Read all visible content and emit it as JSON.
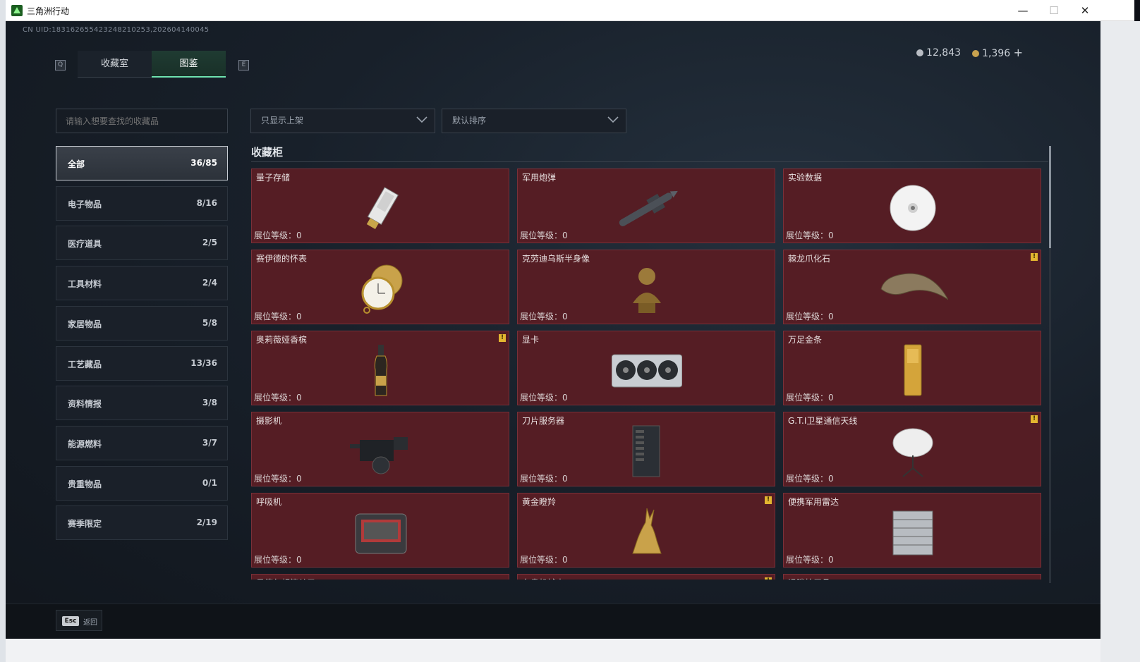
{
  "window": {
    "title": "三角洲行动",
    "controls": [
      "minimize",
      "maximize",
      "close"
    ]
  },
  "header": {
    "uid": "CN UID:1831626554232482102­53,202604140045",
    "silver": "12,843",
    "gold": "1,396",
    "gold_add": "+"
  },
  "tabs": {
    "prev_key": "Q",
    "next_key": "E",
    "items": [
      {
        "label": "收藏室"
      },
      {
        "label": "图鉴",
        "active": true
      }
    ]
  },
  "search": {
    "placeholder": "请输入想要查找的收藏品"
  },
  "filters": {
    "display": "只显示上架",
    "sort": "默认排序"
  },
  "categories": [
    {
      "label": "全部",
      "count": "36/85",
      "active": true
    },
    {
      "label": "电子物品",
      "count": "8/16"
    },
    {
      "label": "医疗道具",
      "count": "2/5"
    },
    {
      "label": "工具材料",
      "count": "2/4"
    },
    {
      "label": "家居物品",
      "count": "5/8"
    },
    {
      "label": "工艺藏品",
      "count": "13/36"
    },
    {
      "label": "资料情报",
      "count": "3/8"
    },
    {
      "label": "能源燃料",
      "count": "3/7"
    },
    {
      "label": "贵重物品",
      "count": "0/1"
    },
    {
      "label": "赛季限定",
      "count": "2/19"
    }
  ],
  "panel": {
    "title": "收藏柜",
    "level_label": "展位等级：0"
  },
  "items": [
    {
      "name": "量子存储",
      "icon": "usb-drive-icon",
      "alert": false
    },
    {
      "name": "军用炮弹",
      "icon": "missile-icon",
      "alert": false
    },
    {
      "name": "实验数据",
      "icon": "disc-icon",
      "alert": false
    },
    {
      "name": "赛伊德的怀表",
      "icon": "pocket-watch-icon",
      "alert": false
    },
    {
      "name": "克劳迪乌斯半身像",
      "icon": "bust-icon",
      "alert": false
    },
    {
      "name": "棘龙爪化石",
      "icon": "claw-fossil-icon",
      "alert": true
    },
    {
      "name": "奥莉薇娅香槟",
      "icon": "champagne-icon",
      "alert": true
    },
    {
      "name": "显卡",
      "icon": "graphics-card-icon",
      "alert": false
    },
    {
      "name": "万足金条",
      "icon": "gold-bar-icon",
      "alert": false
    },
    {
      "name": "摄影机",
      "icon": "camera-icon",
      "alert": false
    },
    {
      "name": "刀片服务器",
      "icon": "server-icon",
      "alert": false
    },
    {
      "name": "G.T.I卫星通信天线",
      "icon": "satellite-dish-icon",
      "alert": true
    },
    {
      "name": "呼吸机",
      "icon": "ventilator-icon",
      "alert": false
    },
    {
      "name": "黄金瞪羚",
      "icon": "golden-gazelle-icon",
      "alert": true
    },
    {
      "name": "便携军用雷达",
      "icon": "radar-icon",
      "alert": false
    },
    {
      "name": "曼德尔超算单元",
      "icon": "supercomputer-icon",
      "alert": false
    },
    {
      "name": "名贵机械表",
      "icon": "watch-icon",
      "alert": true
    },
    {
      "name": "滑膛枪展品",
      "icon": "musket-icon",
      "alert": false
    }
  ],
  "footer": {
    "esc_key": "Esc",
    "back_label": "返回"
  },
  "colors": {
    "card_bg": "#551d24",
    "active_tab": "#6fe3b0",
    "alert": "#e3b630"
  }
}
